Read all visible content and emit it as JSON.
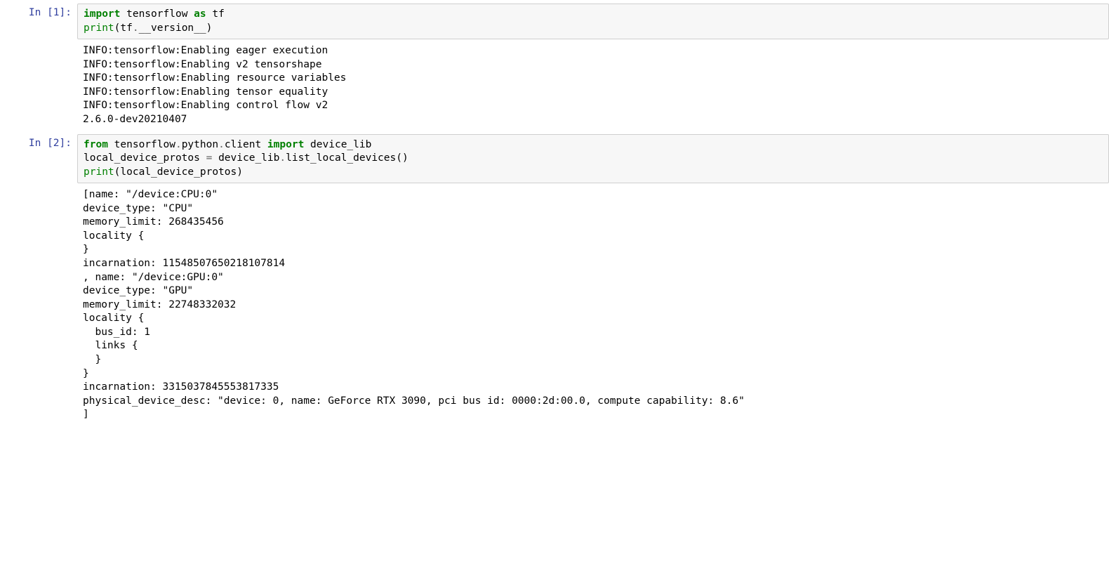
{
  "cells": [
    {
      "prompt": "In [1]:",
      "code_tokens": [
        {
          "t": "import",
          "c": "kw"
        },
        {
          "t": " tensorflow ",
          "c": "id"
        },
        {
          "t": "as",
          "c": "kw"
        },
        {
          "t": " tf",
          "c": "id"
        },
        {
          "t": "\n",
          "c": ""
        },
        {
          "t": "print",
          "c": "nb"
        },
        {
          "t": "(tf",
          "c": "id"
        },
        {
          "t": ".",
          "c": "op"
        },
        {
          "t": "__version__)",
          "c": "id"
        }
      ],
      "output": "INFO:tensorflow:Enabling eager execution\nINFO:tensorflow:Enabling v2 tensorshape\nINFO:tensorflow:Enabling resource variables\nINFO:tensorflow:Enabling tensor equality\nINFO:tensorflow:Enabling control flow v2\n2.6.0-dev20210407"
    },
    {
      "prompt": "In [2]:",
      "code_tokens": [
        {
          "t": "from",
          "c": "kw"
        },
        {
          "t": " tensorflow",
          "c": "id"
        },
        {
          "t": ".",
          "c": "op"
        },
        {
          "t": "python",
          "c": "id"
        },
        {
          "t": ".",
          "c": "op"
        },
        {
          "t": "client ",
          "c": "id"
        },
        {
          "t": "import",
          "c": "kw"
        },
        {
          "t": " device_lib",
          "c": "id"
        },
        {
          "t": "\n",
          "c": ""
        },
        {
          "t": "local_device_protos ",
          "c": "id"
        },
        {
          "t": "=",
          "c": "op"
        },
        {
          "t": " device_lib",
          "c": "id"
        },
        {
          "t": ".",
          "c": "op"
        },
        {
          "t": "list_local_devices()",
          "c": "id"
        },
        {
          "t": "\n",
          "c": ""
        },
        {
          "t": "print",
          "c": "nb"
        },
        {
          "t": "(local_device_protos)",
          "c": "id"
        }
      ],
      "output": "[name: \"/device:CPU:0\"\ndevice_type: \"CPU\"\nmemory_limit: 268435456\nlocality {\n}\nincarnation: 11548507650218107814\n, name: \"/device:GPU:0\"\ndevice_type: \"GPU\"\nmemory_limit: 22748332032\nlocality {\n  bus_id: 1\n  links {\n  }\n}\nincarnation: 3315037845553817335\nphysical_device_desc: \"device: 0, name: GeForce RTX 3090, pci bus id: 0000:2d:00.0, compute capability: 8.6\"\n]"
    }
  ]
}
